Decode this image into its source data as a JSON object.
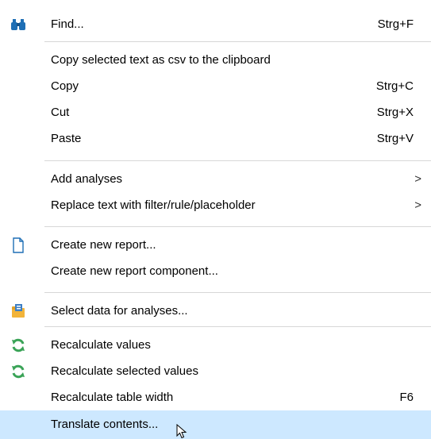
{
  "menu": {
    "find": {
      "label": "Find...",
      "shortcut": "Strg+F",
      "icon": "binoculars-icon"
    },
    "copy_csv": {
      "label": "Copy selected text as csv to the clipboard"
    },
    "copy": {
      "label": "Copy",
      "shortcut": "Strg+C"
    },
    "cut": {
      "label": "Cut",
      "shortcut": "Strg+X"
    },
    "paste": {
      "label": "Paste",
      "shortcut": "Strg+V"
    },
    "add_analyses": {
      "label": "Add analyses",
      "arrow": ">"
    },
    "replace_text": {
      "label": "Replace text with filter/rule/placeholder",
      "arrow": ">"
    },
    "create_report": {
      "label": "Create new report...",
      "icon": "document-icon"
    },
    "create_component": {
      "label": "Create new report component..."
    },
    "select_data": {
      "label": "Select data for analyses...",
      "icon": "data-folder-icon"
    },
    "recalc_values": {
      "label": "Recalculate values",
      "icon": "refresh-icon"
    },
    "recalc_selected": {
      "label": "Recalculate selected values",
      "icon": "refresh-icon"
    },
    "recalc_width": {
      "label": "Recalculate table width",
      "shortcut": "F6"
    },
    "translate": {
      "label": "Translate contents..."
    }
  },
  "colors": {
    "highlight": "#cde8ff",
    "separator": "#d7d7d7",
    "icon_blue": "#1e6fb5",
    "icon_green": "#3aa357"
  }
}
